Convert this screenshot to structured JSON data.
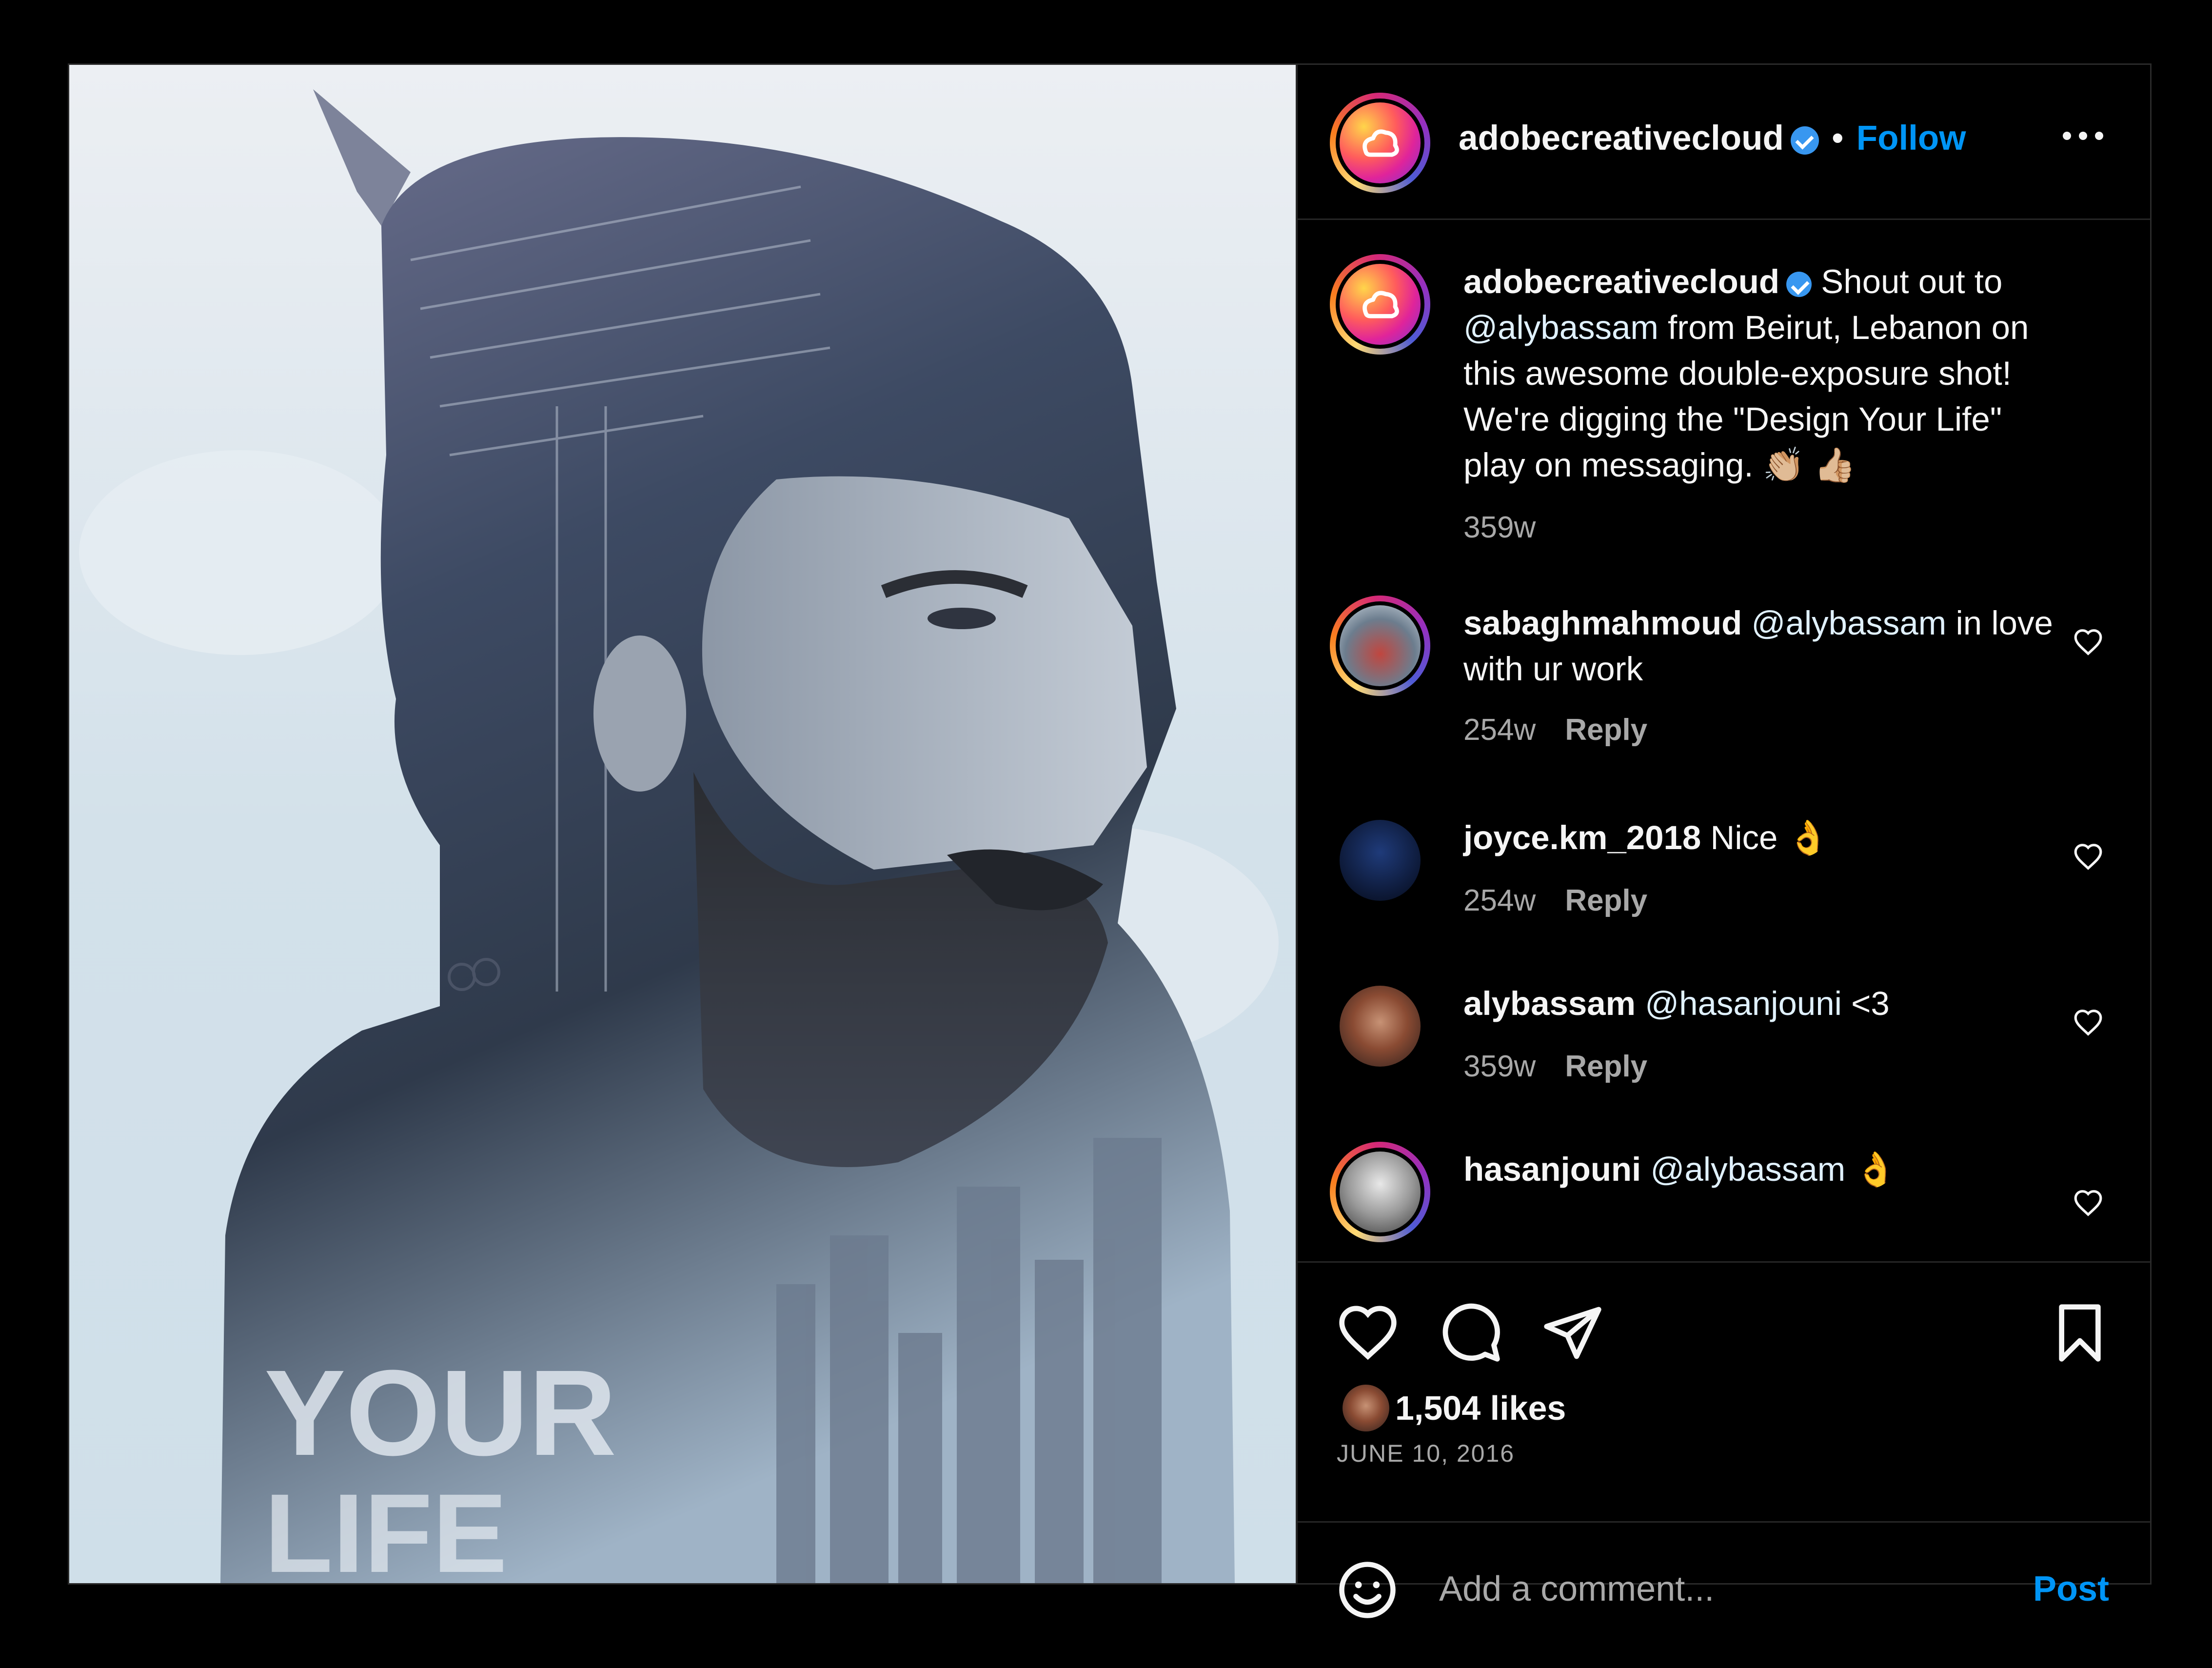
{
  "header": {
    "username": "adobecreativecloud",
    "separator": "•",
    "follow_label": "Follow",
    "more_icon": "more-horizontal-icon"
  },
  "image": {
    "poster_text": [
      "YOUR",
      "LIFE"
    ]
  },
  "caption": {
    "username": "adobecreativecloud",
    "text_before": "Shout out to",
    "mention": "@alybassam",
    "text_after": "from Beirut, Lebanon on this awesome double-exposure shot! We're digging the \"Design Your Life\" play on messaging.",
    "emojis": "👏🏼 👍🏼",
    "time": "359w"
  },
  "comments": [
    {
      "username": "sabaghmahmoud",
      "mention": "@alybassam",
      "text": "in love with ur work",
      "time": "254w",
      "reply_label": "Reply"
    },
    {
      "username": "joyce.km_2018",
      "mention": "",
      "text": "Nice 👌",
      "time": "254w",
      "reply_label": "Reply"
    },
    {
      "username": "alybassam",
      "mention": "@hasanjouni",
      "text": "<3",
      "time": "359w",
      "reply_label": "Reply"
    },
    {
      "username": "hasanjouni",
      "mention": "@alybassam",
      "text": "👌",
      "time": "",
      "reply_label": ""
    }
  ],
  "actions": {
    "like_icon": "heart-icon",
    "comment_icon": "comment-bubble-icon",
    "share_icon": "paper-plane-icon",
    "save_icon": "bookmark-icon"
  },
  "likes": "1,504 likes",
  "date": "JUNE 10, 2016",
  "add_comment": {
    "placeholder": "Add a comment...",
    "post_label": "Post"
  },
  "colors": {
    "accent": "#0095f6",
    "verified": "#3897f0",
    "muted": "#a8a8a8",
    "background": "#000000",
    "border": "#262626"
  }
}
